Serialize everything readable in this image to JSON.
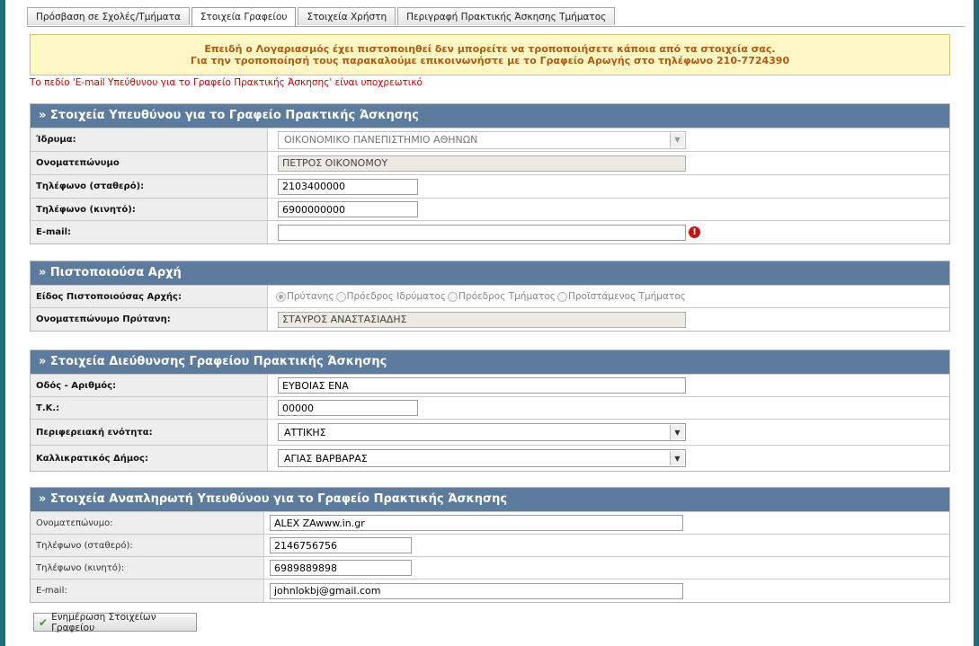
{
  "tabs": [
    {
      "label": "Πρόσβαση σε Σχολές/Τμήματα"
    },
    {
      "label": "Στοιχεία Γραφείου"
    },
    {
      "label": "Στοιχεία Χρήστη"
    },
    {
      "label": "Περιγραφή Πρακτικής Άσκησης Τμήματος"
    }
  ],
  "notice": {
    "line1": "Επειδή ο Λογαριασμός έχει πιστοποιηθεί δεν μπορείτε να τροποποιήσετε κάποια από τα στοιχεία σας.",
    "line2": "Για την τροποποίησή τους παρακαλούμε επικοινωνήστε με το Γραφείο Αρωγής στο τηλέφωνο 210-7724390"
  },
  "error_message": "Το πεδίο 'E-mail Υπεύθυνου για το Γραφείο Πρακτικής Άσκησης' είναι υποχρεωτικό",
  "responsible": {
    "title": "» Στοιχεία Υπευθύνου για το Γραφείο Πρακτικής Άσκησης",
    "institution_label": "Ίδρυμα:",
    "institution_value": "ΟΙΚΟΝΟΜΙΚΟ ΠΑΝΕΠΙΣΤΗΜΙΟ ΑΘΗΝΩΝ",
    "name_label": "Ονοματεπώνυμο",
    "name_value": "ΠΕΤΡΟΣ ΟΙΚΟΝΟΜΟΥ",
    "phone_label": "Τηλέφωνο (σταθερό):",
    "phone_value": "2103400000",
    "mobile_label": "Τηλέφωνο (κινητό):",
    "mobile_value": "6900000000",
    "email_label": "E-mail:",
    "email_value": "",
    "error_icon": "!"
  },
  "authority": {
    "title": "» Πιστοποιούσα Αρχή",
    "type_label": "Είδος Πιστοποιούσας Αρχής:",
    "options": [
      "Πρύτανης",
      "Πρόεδρος Ιδρύματος",
      "Πρόεδρος Τμήματος",
      "Προϊστάμενος Τμήματος"
    ],
    "selected": "Πρύτανης",
    "rector_label": "Ονοματεπώνυμο Πρύτανη:",
    "rector_value": "ΣΤΑΥΡΟΣ ΑΝΑΣΤΑΣΙΑΔΗΣ"
  },
  "address": {
    "title": "» Στοιχεία Διεύθυνσης Γραφείου Πρακτικής Άσκησης",
    "street_label": "Οδός - Αριθμός:",
    "street_value": "ΕΥΒΟΙΑΣ ΕΝΑ",
    "zip_label": "Τ.Κ.:",
    "zip_value": "00000",
    "region_label": "Περιφερειακή ενότητα:",
    "region_value": "ΑΤΤΙΚΗΣ",
    "municipality_label": "Καλλικρατικός Δήμος:",
    "municipality_value": "ΑΓΙΑΣ ΒΑΡΒΑΡΑΣ"
  },
  "deputy": {
    "title": "» Στοιχεία Αναπληρωτή Υπευθύνου για το Γραφείο Πρακτικής Άσκησης",
    "name_label": "Ονοματεπώνυμο:",
    "name_value": "ALEX ZAwww.in.gr",
    "phone_label": "Τηλέφωνο (σταθερό):",
    "phone_value": "2146756756",
    "mobile_label": "Τηλέφωνο (κινητό):",
    "mobile_value": "6989889898",
    "email_label": "E-mail:",
    "email_value": "johnlokbj@gmail.com"
  },
  "update_button": "Ενημέρωση Στοιχείων Γραφείου"
}
